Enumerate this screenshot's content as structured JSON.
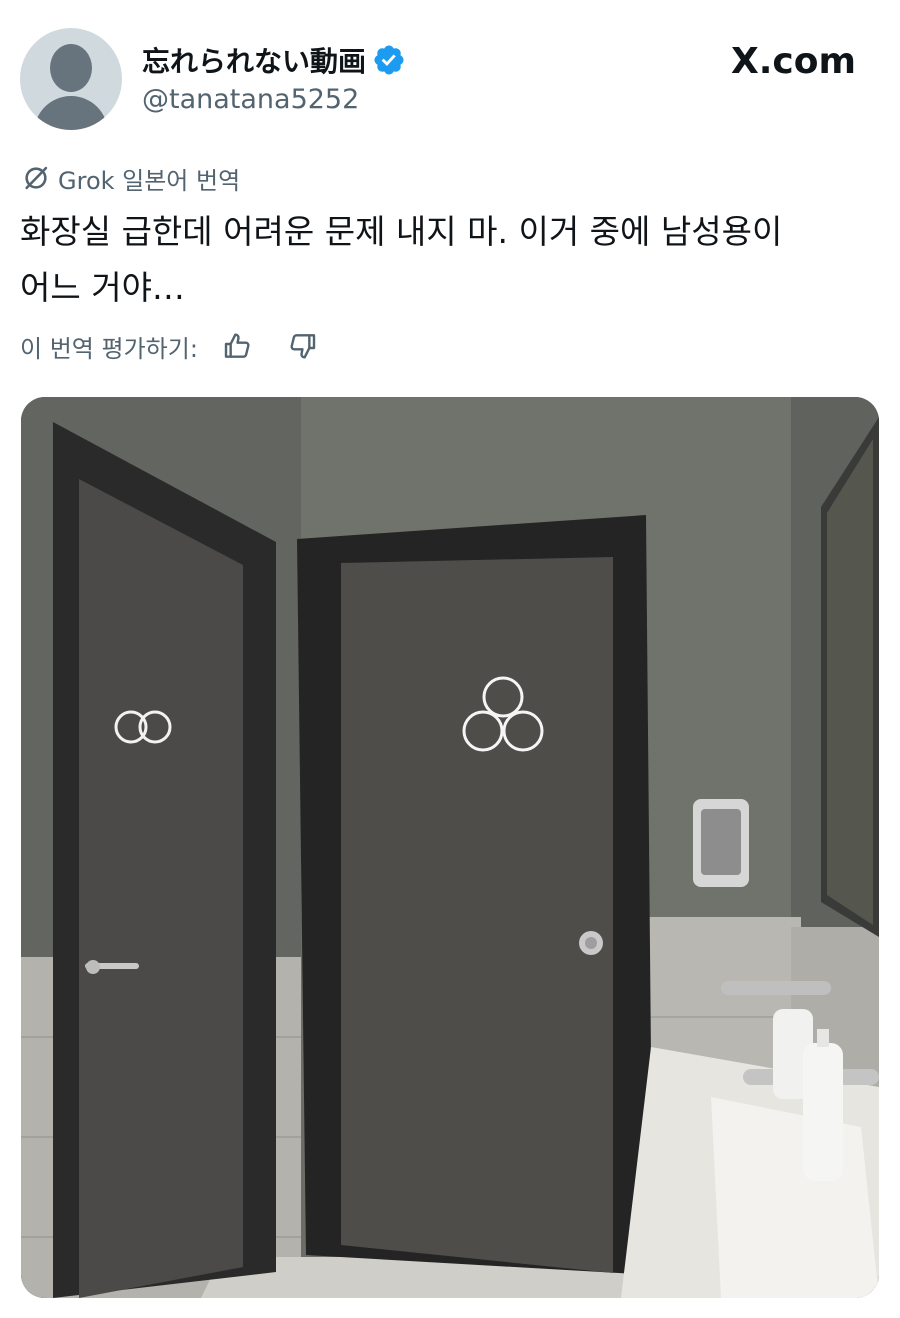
{
  "author": {
    "display_name": "忘れられない動画",
    "handle": "@tanatana5252",
    "verified": true
  },
  "site_brand": "X.com",
  "translation": {
    "label": "Grok 일본어 번역",
    "icon": "grok-icon"
  },
  "tweet": {
    "lines": [
      "화장실 급한데 어려운 문제 내지 마. 이거 중에 남성용이",
      "어느 거야…"
    ]
  },
  "rating": {
    "label": "이 번역 평가하기:",
    "thumbs_up_icon": "thumbs-up-icon",
    "thumbs_down_icon": "thumbs-down-icon"
  },
  "media": {
    "description_icon": "photo-restroom-doors"
  },
  "colors": {
    "verified_badge": "#1d9bf0",
    "secondary_text": "#536471",
    "primary_text": "#0f1419"
  }
}
